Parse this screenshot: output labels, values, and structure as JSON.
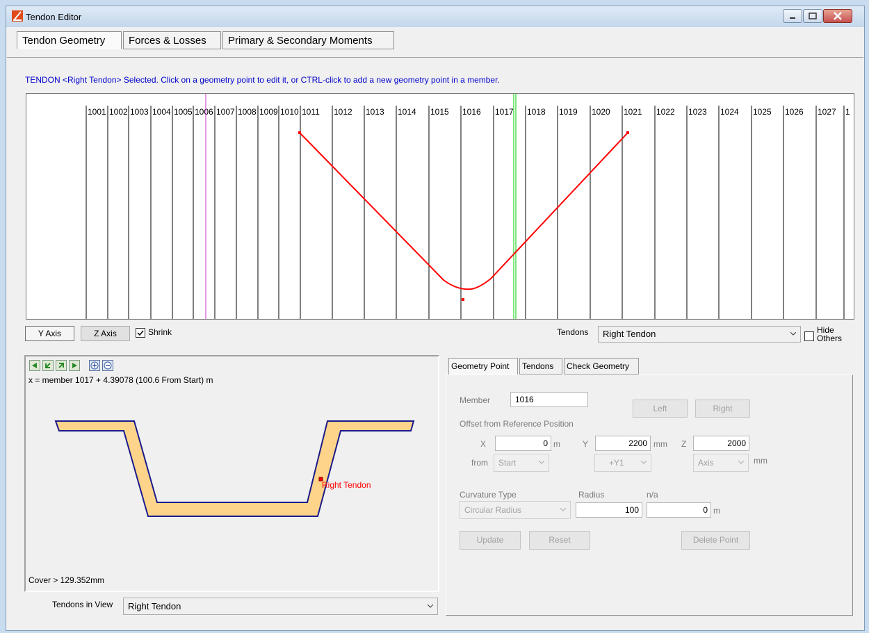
{
  "window": {
    "title": "Tendon Editor"
  },
  "main_tabs": [
    {
      "label": "Tendon Geometry",
      "selected": true
    },
    {
      "label": "Forces & Losses",
      "selected": false
    },
    {
      "label": "Primary & Secondary Moments",
      "selected": false
    }
  ],
  "hint": "TENDON <Right Tendon> Selected.  Click on a geometry point to edit it, or CTRL-click to add a new geometry point in a member.",
  "members": [
    "1001",
    "1002",
    "1003",
    "1004",
    "1005",
    "1006",
    "1007",
    "1008",
    "1009",
    "1010",
    "1011",
    "1012",
    "1013",
    "1014",
    "1015",
    "1016",
    "1017",
    "1018",
    "1019",
    "1020",
    "1021",
    "1022",
    "1023",
    "1024",
    "1025",
    "1026",
    "1027",
    "1"
  ],
  "axis_buttons": {
    "y": "Y Axis",
    "z": "Z Axis",
    "shrink": "Shrink",
    "shrink_checked": true
  },
  "tendons_label": "Tendons",
  "tendons_value": "Right Tendon",
  "hide_others": {
    "line1": "Hide",
    "line2": "Others",
    "checked": false
  },
  "section": {
    "position_text": "x = member 1017 + 4.39078 (100.6 From Start) m",
    "tendon_label": "Right Tendon",
    "cover_text": "Cover > 129.352mm",
    "tools": [
      "first-icon",
      "prev-icon",
      "next-icon",
      "last-icon",
      "zoom-in-icon",
      "zoom-out-icon"
    ]
  },
  "tendons_in_view": {
    "label": "Tendons in View",
    "value": "Right Tendon"
  },
  "sub_tabs": [
    {
      "label": "Geometry Point",
      "selected": true
    },
    {
      "label": "Tendons",
      "selected": false
    },
    {
      "label": "Check Geometry",
      "selected": false
    }
  ],
  "geometry": {
    "member_label": "Member",
    "member_value": "1016",
    "left_label": "Left",
    "right_label": "Right",
    "offset_label": "Offset from Reference Position",
    "x_label": "X",
    "x_value": "0",
    "x_unit": "m",
    "y_label": "Y",
    "y_value": "2200",
    "y_unit": "mm",
    "z_label": "Z",
    "z_value": "2000",
    "z_unit": "mm",
    "from_label": "from",
    "from_value": "Start",
    "y_ref": "+Y1",
    "z_ref": "Axis",
    "curvature_label": "Curvature Type",
    "curvature_value": "Circular Radius",
    "radius_label": "Radius",
    "radius_value": "100",
    "na_label": "n/a",
    "na_value": "0",
    "na_unit": "m",
    "update_label": "Update",
    "reset_label": "Reset",
    "delete_label": "Delete Point"
  },
  "colors": {
    "tendon": "#ff0000",
    "section_fill": "#fdd48a",
    "section_edge": "#1a1a8c",
    "current_marker": "#00cc00",
    "start_marker": "#cc33cc",
    "hint": "#0000cc"
  }
}
